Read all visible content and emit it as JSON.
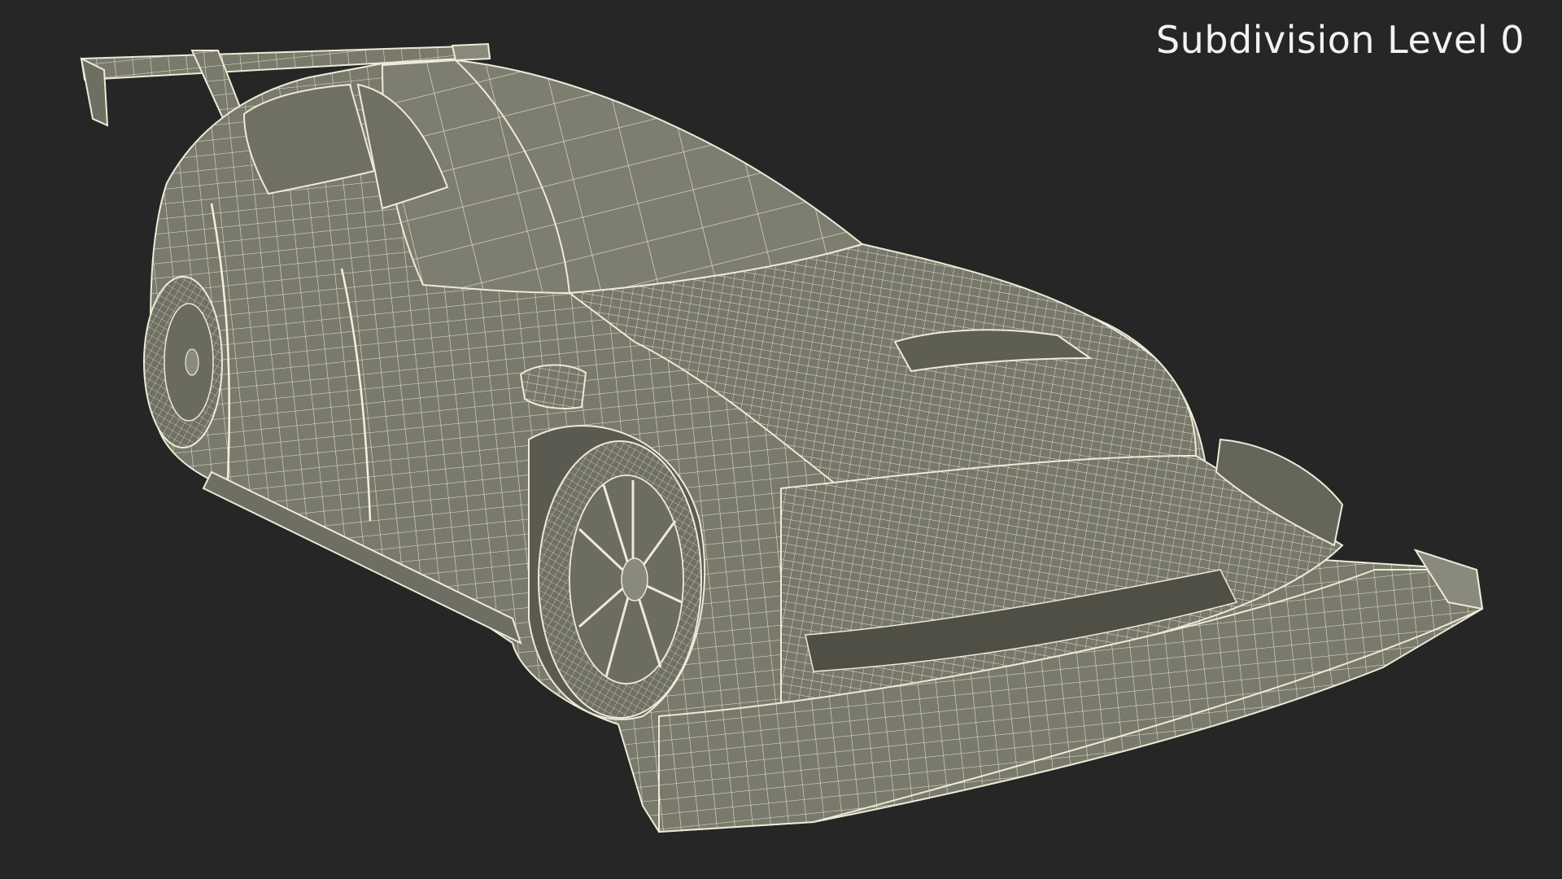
{
  "viewport": {
    "label": "Subdivision Level 0",
    "background_color": "#262626",
    "mesh_surface_color": "#7b7b6e",
    "mesh_wire_color": "#ecebd8"
  },
  "model": {
    "icon": "wireframe-race-car-icon"
  }
}
